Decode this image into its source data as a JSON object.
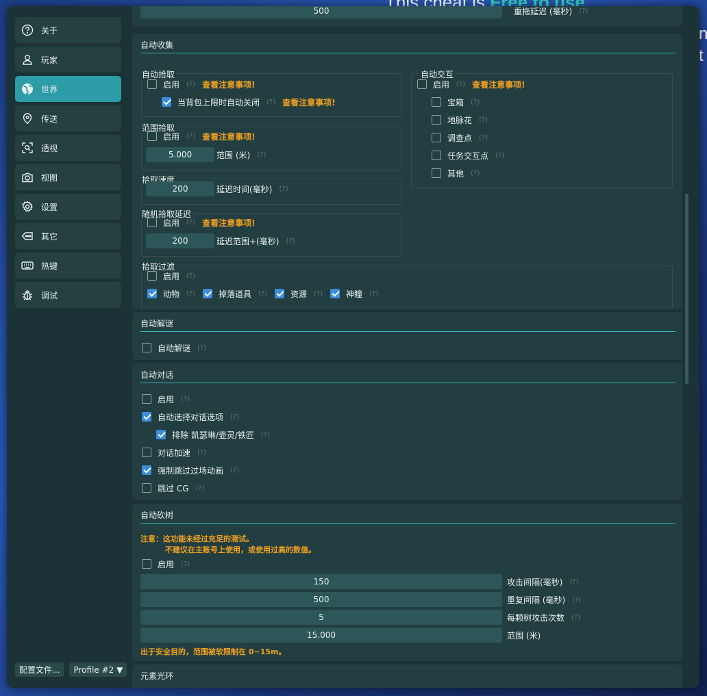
{
  "background": {
    "cheat_text_prefix": "This cheat is ",
    "cheat_text_emph": "Free to use"
  },
  "sidebar": {
    "items": [
      {
        "label": "关于",
        "icon": "help-circle-icon"
      },
      {
        "label": "玩家",
        "icon": "user-icon"
      },
      {
        "label": "世界",
        "icon": "globe-icon",
        "active": true
      },
      {
        "label": "传送",
        "icon": "location-pin-icon"
      },
      {
        "label": "透视",
        "icon": "scan-search-icon"
      },
      {
        "label": "视图",
        "icon": "camera-icon"
      },
      {
        "label": "设置",
        "icon": "gear-icon"
      },
      {
        "label": "其它",
        "icon": "tag-icon"
      },
      {
        "label": "热键",
        "icon": "keyboard-icon"
      },
      {
        "label": "调试",
        "icon": "bug-icon"
      }
    ],
    "config_button": "配置文件...",
    "profile_select": "Profile #2 ▼"
  },
  "top_partial": {
    "value": "500",
    "label": "重拖延迟 (毫秒)"
  },
  "help_mark": "(?)",
  "auto_collect": {
    "title": "自动收集",
    "auto_pickup": {
      "title": "自动拾取",
      "enable": "启用",
      "enable_checked": false,
      "warn": "查看注意事项!",
      "close_full": "当背包上限时自动关闭",
      "close_full_checked": true,
      "close_full_warn": "查看注意事项!"
    },
    "range_pickup": {
      "title": "范围拾取",
      "enable": "启用",
      "enable_checked": false,
      "warn": "查看注意事项!",
      "range_value": "5.000",
      "range_label": "范围 (米)"
    },
    "pickup_speed": {
      "title": "拾取速度",
      "value": "200",
      "label": "延迟时间(毫秒)"
    },
    "random_delay": {
      "title": "随机拾取延迟",
      "enable": "启用",
      "enable_checked": false,
      "warn": "查看注意事项!",
      "value": "200",
      "label": "延迟范围+(毫秒)"
    },
    "auto_interact": {
      "title": "自动交互",
      "enable": "启用",
      "enable_checked": false,
      "warn": "查看注意事项!",
      "items": [
        {
          "label": "宝箱",
          "checked": false
        },
        {
          "label": "地脉花",
          "checked": false
        },
        {
          "label": "调查点",
          "checked": false
        },
        {
          "label": "任务交互点",
          "checked": false
        },
        {
          "label": "其他",
          "checked": false
        }
      ]
    },
    "pickup_filter": {
      "title": "拾取过滤",
      "enable": "启用",
      "enable_checked": false,
      "items": [
        {
          "label": "动物",
          "checked": true
        },
        {
          "label": "掉落道具",
          "checked": true
        },
        {
          "label": "资源",
          "checked": true
        },
        {
          "label": "神瞳",
          "checked": true
        }
      ]
    }
  },
  "auto_puzzle": {
    "title": "自动解谜",
    "option": "自动解谜",
    "checked": false
  },
  "auto_talk": {
    "title": "自动对话",
    "options": [
      {
        "label": "启用",
        "checked": false
      },
      {
        "label": "自动选择对话选项",
        "checked": true
      },
      {
        "label": "排除 凯瑟琳/壶灵/铁匠",
        "checked": true
      },
      {
        "label": "对话加速",
        "checked": false
      },
      {
        "label": "强制跳过过场动画",
        "checked": true
      },
      {
        "label": "跳过 CG",
        "checked": false
      }
    ]
  },
  "auto_tree": {
    "title": "自动砍树",
    "note_line1": "注意：这功能未经过充足的测试。",
    "note_line2": "不建议在主账号上使用，或使用过高的数值。",
    "enable": "启用",
    "enable_checked": false,
    "fields": [
      {
        "value": "150",
        "label": "攻击间隔(毫秒)"
      },
      {
        "value": "500",
        "label": "重复间隔 (毫秒)"
      },
      {
        "value": "5",
        "label": "每颗树攻击次数"
      },
      {
        "value": "15.000",
        "label": "范围 (米)"
      }
    ],
    "safety_note": "出于安全目的，范围被软限制在 0~15m。"
  },
  "next_panel_title": "元素光环"
}
